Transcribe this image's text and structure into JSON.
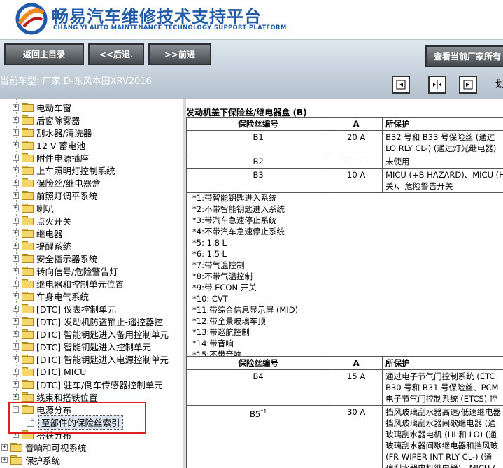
{
  "header": {
    "title_cn": "畅易汽车维修技术支持平台",
    "title_en": "CHANG YI AUTO MAINTENANCE TECHNOLOGY SUPPORT PLATFORM",
    "brand_color": "#1f5aa8",
    "logo_icon": "chang-yi-logo"
  },
  "toolbar": {
    "home_label": "返回主目录",
    "back_label": "<<后退.",
    "forward_label": ">>前进",
    "view_all_label": "查看当前厂家所有"
  },
  "car_bar": {
    "label": "当前车型:  厂家:D-东风本田XRV2016",
    "extra": "划"
  },
  "tree": {
    "items": [
      {
        "label": "电动车窗"
      },
      {
        "label": "后窗除雾器"
      },
      {
        "label": "刮水器/清洗器"
      },
      {
        "label": "12 V 蓄电池"
      },
      {
        "label": "附件电源插座"
      },
      {
        "label": "上车照明灯控制系统"
      },
      {
        "label": "保险丝/继电器盒"
      },
      {
        "label": "前照灯调平系统"
      },
      {
        "label": "喇叭"
      },
      {
        "label": "点火开关"
      },
      {
        "label": "继电器"
      },
      {
        "label": "提醒系统"
      },
      {
        "label": "安全指示器系统"
      },
      {
        "label": "转向信号/危险警告灯"
      },
      {
        "label": "继电器和控制单元位置"
      },
      {
        "label": "车身电气系统"
      },
      {
        "label": "[DTC] 仪表控制单元"
      },
      {
        "label": "[DTC] 发动机防盗锁止-遥控器控"
      },
      {
        "label": "[DTC] 智能钥匙进入备用控制单元"
      },
      {
        "label": "[DTC] 智能钥匙进入控制单元"
      },
      {
        "label": "[DTC] 智能钥匙进入电源控制单元"
      },
      {
        "label": "[DTC] MICU"
      },
      {
        "label": "[DTC] 驻车/倒车传感器控制单元"
      },
      {
        "label": "线束和搭铁位置"
      }
    ],
    "expanded_item": {
      "label": "电源分布"
    },
    "selected_child": {
      "label": "至部件的保险丝索引"
    },
    "after_items": [
      {
        "label": "搭铁分布"
      }
    ],
    "root_items": [
      {
        "label": "音响和可视系统"
      },
      {
        "label": "保护系统"
      }
    ]
  },
  "content": {
    "section_title": "发动机盖下保险丝/继电器盒 (B)",
    "table1": {
      "headers": [
        "保险丝编号",
        "A",
        "所保护"
      ],
      "rows": [
        {
          "fuse": "B1",
          "amp": "20 A",
          "lines": [
            "B32 号和 B33 号保险丝 (通过",
            "LO RLY CL-) (通过灯光继电器)"
          ]
        },
        {
          "fuse": "B2",
          "amp": "———",
          "lines": [
            "未使用"
          ]
        },
        {
          "fuse": "B3",
          "amp": "10 A",
          "lines": [
            "MICU (+B HAZARD)、MICU (H",
            "关)、危险警告开关"
          ]
        }
      ]
    },
    "notes": [
      "*1:带智能钥匙进入系统",
      "*2:不带智能钥匙进入系统",
      "*3:带汽车急速停止系统",
      "*4:不带汽车急速停止系统",
      "*5: 1.8 L",
      "*6: 1.5 L",
      "*7:带气温控制",
      "*8:不带气温控制",
      "*9:带 ECON 开关",
      "*10: CVT",
      "*11:带综合信息显示屏 (MID)",
      "*12:带全景玻璃车顶",
      "*13:带巡航控制",
      "*14:带音响",
      "*15:不带音响"
    ],
    "table2": {
      "headers": [
        "保险丝编号",
        "A",
        "所保护"
      ],
      "rows": [
        {
          "fuse": "B4",
          "sup": "",
          "amp": "15 A",
          "lines": [
            "通过电子节气门控制系统 (ETC",
            "B30 号和 B31 号保险丝、PCM",
            "电子节气门控制系统 (ETCS) 控"
          ]
        },
        {
          "fuse": "B5",
          "sup": "*1",
          "amp": "30 A",
          "lines": [
            "挡风玻璃刮水器高速/低速继电器",
            "挡风玻璃刮水器间歇继电器 (通",
            "玻璃刮水器电机 (HI 和 LO) (通",
            "玻璃刮水器间歇继电器和挡风玻",
            "(FR WIPER INT RLY CL-) (通",
            "璃刮水器电机继电器)、MICU ("
          ]
        }
      ]
    }
  }
}
